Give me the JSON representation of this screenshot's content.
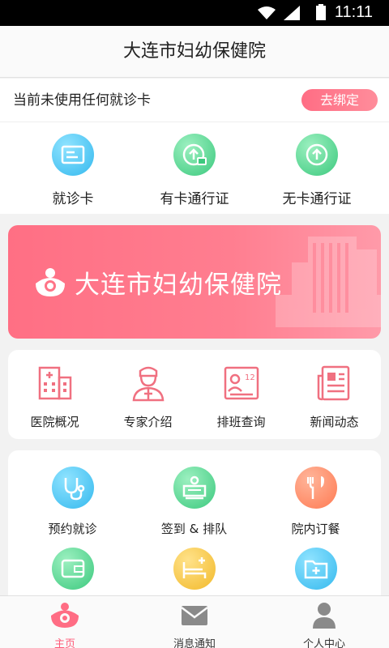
{
  "status_bar": {
    "time": "11:11"
  },
  "header": {
    "title": "大连市妇幼保健院"
  },
  "card_bar": {
    "message": "当前未使用任何就诊卡",
    "bind_button": "去绑定"
  },
  "quick_actions": [
    {
      "label": "就诊卡",
      "icon": "card-icon"
    },
    {
      "label": "有卡通行证",
      "icon": "upload-card-icon"
    },
    {
      "label": "无卡通行证",
      "icon": "upload-icon"
    }
  ],
  "banner": {
    "hospital_name": "大连市妇幼保健院"
  },
  "info_menu": [
    {
      "label": "医院概况",
      "icon": "hospital-icon"
    },
    {
      "label": "专家介绍",
      "icon": "doctor-icon"
    },
    {
      "label": "排班查询",
      "icon": "schedule-icon",
      "badge": "12"
    },
    {
      "label": "新闻动态",
      "icon": "news-icon"
    }
  ],
  "service_menu": [
    {
      "label": "预约就诊",
      "icon": "stethoscope-icon"
    },
    {
      "label": "签到 & 排队",
      "icon": "queue-icon"
    },
    {
      "label": "院内订餐",
      "icon": "meal-icon"
    },
    {
      "label": "",
      "icon": "wallet-icon"
    },
    {
      "label": "",
      "icon": "bed-icon"
    },
    {
      "label": "",
      "icon": "medical-folder-icon"
    }
  ],
  "tab_bar": [
    {
      "label": "主页",
      "icon": "home-logo-icon",
      "active": true
    },
    {
      "label": "消息通知",
      "icon": "mail-icon",
      "active": false
    },
    {
      "label": "个人中心",
      "icon": "person-icon",
      "active": false
    }
  ],
  "colors": {
    "accent": "#ff6d84",
    "blue_icon": "#4fc3f7",
    "green_icon": "#5fd99a",
    "yellow_icon": "#f5c94a",
    "orange_icon": "#ff8a65"
  }
}
